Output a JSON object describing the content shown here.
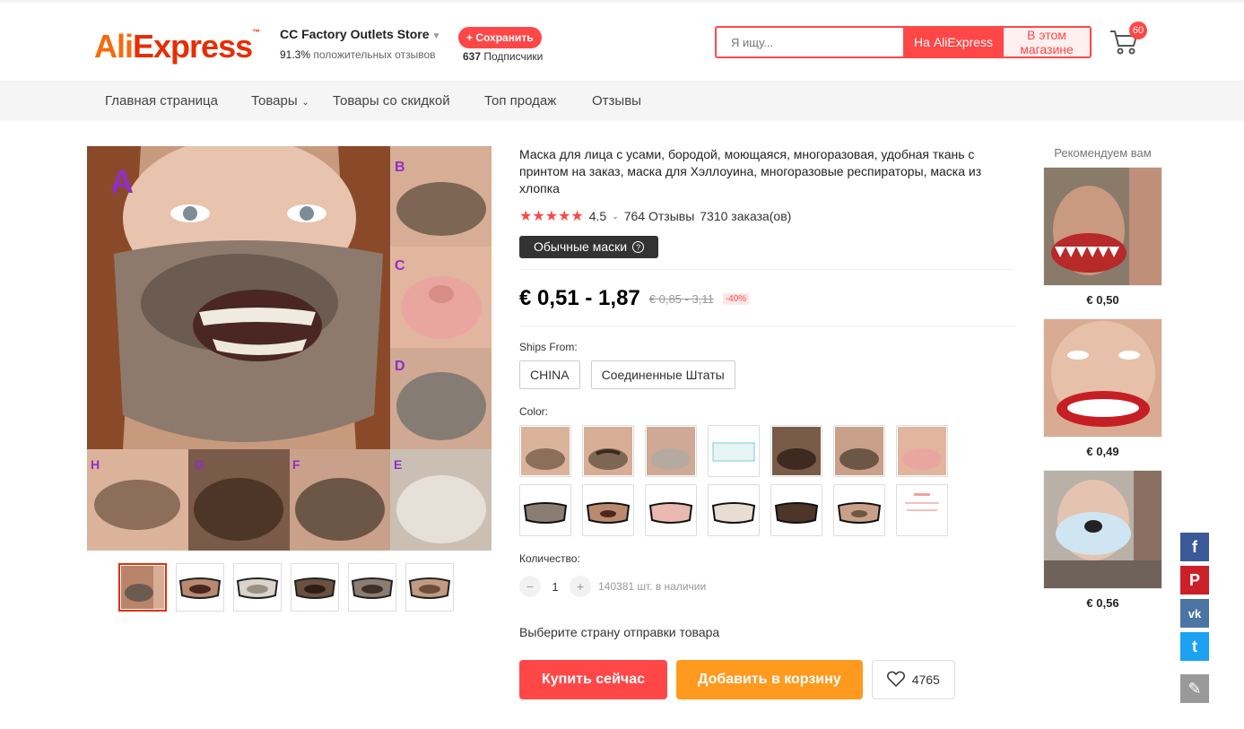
{
  "header": {
    "logo_ali": "Ali",
    "logo_express": "Express",
    "logo_tm": "™",
    "store_name": "CC Factory Outlets Store",
    "positive_pct": "91.3%",
    "positive_label": "положительных отзывов",
    "follow_label": "+ Сохранить",
    "followers_count": "637",
    "followers_label": "Подписчики",
    "search_placeholder": "Я ищу...",
    "search_ali_label": "На AliExpress",
    "search_store_label": "В этом магазине",
    "cart_count": "60"
  },
  "nav": {
    "items": [
      "Главная страница",
      "Товары",
      "Товары со скидкой",
      "Топ продаж",
      "Отзывы"
    ]
  },
  "gallery": {
    "letters": [
      "A",
      "B",
      "C",
      "D",
      "H",
      "G",
      "F",
      "E"
    ],
    "thumb_count": 6
  },
  "product": {
    "title": "Маска для лица с усами, бородой, моющаяся, многоразовая, удобная ткань с принтом на заказ, маска для Хэллоуина, многоразовые респираторы, маска из хлопка",
    "rating": "4.5",
    "reviews": "764 Отзывы",
    "orders": "7310 заказа(ов)",
    "chip": "Обычные маски",
    "price": "€ 0,51 - 1,87",
    "old_price": "€ 0,85 - 3,11",
    "discount": "-40%",
    "ships_from_label": "Ships From:",
    "ships_options": [
      "CHINA",
      "Соединенные Штаты"
    ],
    "color_label": "Color:",
    "quantity_label": "Количество:",
    "quantity_value": "1",
    "stock": "140381 шт. в наличии",
    "ship_note": "Выберите страну отправки товара",
    "buy_label": "Купить сейчас",
    "add_label": "Добавить в корзину",
    "wish_count": "4765"
  },
  "recommend": {
    "title": "Рекомендуем вам",
    "prices": [
      "€ 0,50",
      "€ 0,49",
      "€ 0,56"
    ]
  },
  "social": [
    {
      "name": "facebook-icon",
      "glyph": "f",
      "color": "#3b5998"
    },
    {
      "name": "pinterest-icon",
      "glyph": "P",
      "color": "#cb2027"
    },
    {
      "name": "vk-icon",
      "glyph": "vk",
      "color": "#4c75a3"
    },
    {
      "name": "twitter-icon",
      "glyph": "t",
      "color": "#1da1f2"
    },
    {
      "name": "edit-icon",
      "glyph": "✎",
      "color": "#999999"
    }
  ],
  "colors": {
    "accent": "#ff4747",
    "orange": "#ff9a1f",
    "logo_orange": "#f76a0c",
    "logo_red": "#e62e04"
  }
}
